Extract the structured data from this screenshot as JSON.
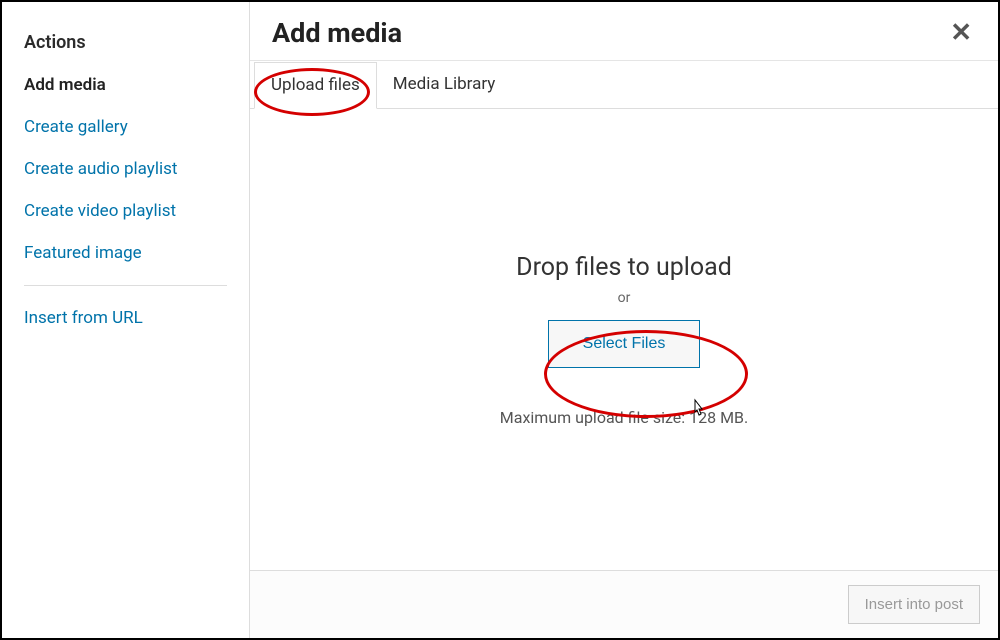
{
  "sidebar": {
    "heading": "Actions",
    "items": [
      {
        "label": "Add media",
        "current": true
      },
      {
        "label": "Create gallery"
      },
      {
        "label": "Create audio playlist"
      },
      {
        "label": "Create video playlist"
      },
      {
        "label": "Featured image"
      }
    ],
    "insert_url": "Insert from URL"
  },
  "header": {
    "title": "Add media"
  },
  "tabs": {
    "upload": "Upload files",
    "library": "Media Library"
  },
  "drop": {
    "title": "Drop files to upload",
    "or": "or",
    "select_button": "Select Files",
    "hint": "Maximum upload file size: 128 MB."
  },
  "footer": {
    "insert_button": "Insert into post"
  }
}
